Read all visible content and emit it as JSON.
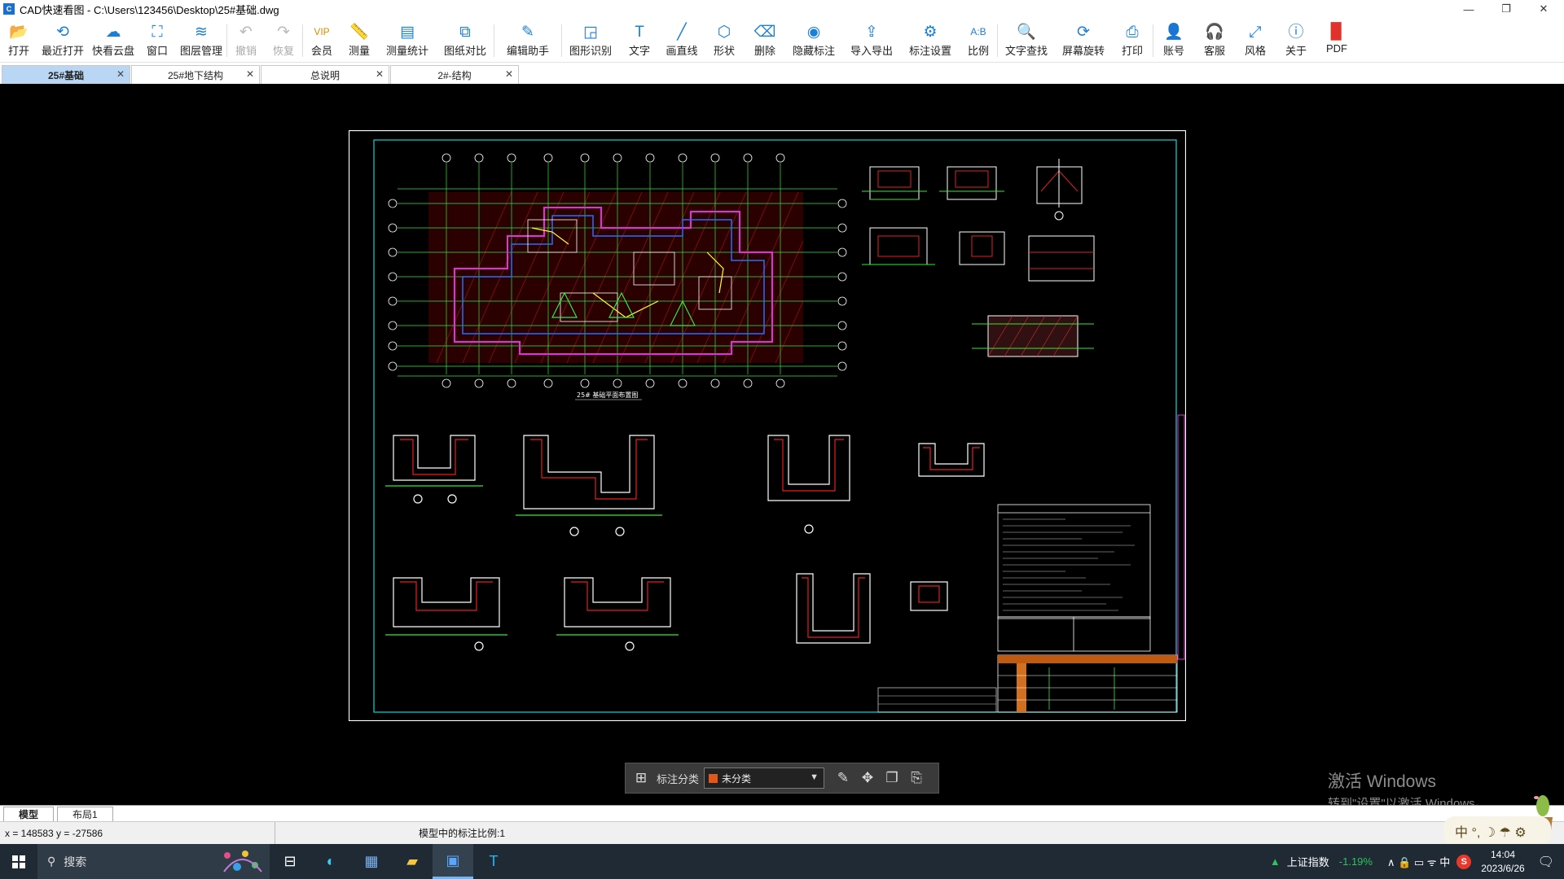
{
  "window": {
    "title": "CAD快速看图 - C:\\Users\\123456\\Desktop\\25#基础.dwg",
    "controls": [
      "—",
      "❐",
      "✕"
    ]
  },
  "toolbar": [
    {
      "label": "打开",
      "icon": "folder-open-icon",
      "glyph": "📂"
    },
    {
      "label": "最近打开",
      "icon": "recent-icon",
      "glyph": "⟲"
    },
    {
      "label": "快看云盘",
      "icon": "cloud-icon",
      "glyph": "☁"
    },
    {
      "label": "窗口",
      "icon": "window-icon",
      "glyph": "⛶"
    },
    {
      "label": "图层管理",
      "icon": "layers-icon",
      "glyph": "≋"
    },
    {
      "label": "撤销",
      "icon": "undo-icon",
      "glyph": "↶",
      "disabled": true
    },
    {
      "label": "恢复",
      "icon": "redo-icon",
      "glyph": "↷",
      "disabled": true
    },
    {
      "label": "会员",
      "icon": "vip-icon",
      "glyph": "VIP",
      "accent": "#d98f00"
    },
    {
      "label": "测量",
      "icon": "measure-icon",
      "glyph": "📏"
    },
    {
      "label": "测量统计",
      "icon": "measure-stats-icon",
      "glyph": "▤"
    },
    {
      "label": "图纸对比",
      "icon": "compare-icon",
      "glyph": "⧉"
    },
    {
      "label": "编辑助手",
      "icon": "edit-assistant-icon",
      "glyph": "✎"
    },
    {
      "label": "图形识别",
      "icon": "shape-recognize-icon",
      "glyph": "◲"
    },
    {
      "label": "文字",
      "icon": "text-icon",
      "glyph": "T"
    },
    {
      "label": "画直线",
      "icon": "line-icon",
      "glyph": "╱"
    },
    {
      "label": "形状",
      "icon": "shape-icon",
      "glyph": "⬡"
    },
    {
      "label": "删除",
      "icon": "eraser-icon",
      "glyph": "⌫"
    },
    {
      "label": "隐藏标注",
      "icon": "hide-annotation-icon",
      "glyph": "◉"
    },
    {
      "label": "导入导出",
      "icon": "import-export-icon",
      "glyph": "⇪"
    },
    {
      "label": "标注设置",
      "icon": "annotation-settings-icon",
      "glyph": "⚙"
    },
    {
      "label": "比例",
      "icon": "scale-icon",
      "glyph": "A:B"
    },
    {
      "label": "文字查找",
      "icon": "text-search-icon",
      "glyph": "🔍"
    },
    {
      "label": "屏幕旋转",
      "icon": "rotate-screen-icon",
      "glyph": "⟳"
    },
    {
      "label": "打印",
      "icon": "print-icon",
      "glyph": "⎙"
    },
    {
      "label": "账号",
      "icon": "account-icon",
      "glyph": "👤"
    },
    {
      "label": "客服",
      "icon": "headset-icon",
      "glyph": "🎧"
    },
    {
      "label": "风格",
      "icon": "style-icon",
      "glyph": "⤢"
    },
    {
      "label": "关于",
      "icon": "info-icon",
      "glyph": "ⓘ"
    },
    {
      "label": "PDF",
      "icon": "pdf-icon",
      "glyph": "▉",
      "accent": "#e0322b"
    }
  ],
  "tabs": [
    {
      "label": "25#基础",
      "active": true
    },
    {
      "label": "25#地下结构"
    },
    {
      "label": "总说明"
    },
    {
      "label": "2#-结构"
    }
  ],
  "float_tool": {
    "label": "标注分类",
    "select_value": "未分类"
  },
  "watermark": {
    "line1": "激活 Windows",
    "line2": "转到\"设置\"以激活 Windows。"
  },
  "layout_tabs": [
    {
      "label": "模型",
      "active": true
    },
    {
      "label": "布局1"
    }
  ],
  "status": {
    "coords": "x = 148583 y = -27586",
    "scale_text": "模型中的标注比例:1"
  },
  "ime": {
    "text": "中 °, ☽ ☂ ⚙"
  },
  "taskbar": {
    "search_placeholder": "搜索",
    "stock_name": "上证指数",
    "stock_change": "-1.19%",
    "time": "14:04",
    "date": "2023/6/26",
    "tray_icons": "∧ 🔒 ▭ ᯤ 中"
  },
  "drawing": {
    "plan_title": "25# 基础平面布置图"
  }
}
